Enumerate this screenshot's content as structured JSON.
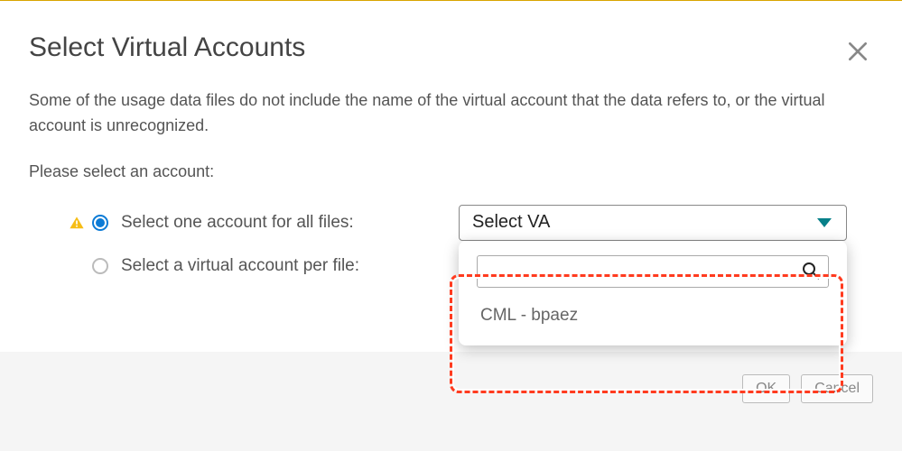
{
  "dialog": {
    "title": "Select Virtual Accounts",
    "description": "Some of the usage data files do not include the name of the virtual account that the data refers to, or the virtual account is unrecognized.",
    "prompt": "Please select an account:",
    "options": {
      "all_files_label": "Select one account for all files:",
      "per_file_label": "Select a virtual account per file:",
      "selected": "all_files"
    },
    "select": {
      "placeholder": "Select VA",
      "search_value": "",
      "items": [
        "CML - bpaez"
      ]
    },
    "buttons": {
      "ok": "OK",
      "cancel": "Cancel"
    }
  },
  "icons": {
    "close": "close-icon",
    "warning": "warning-icon",
    "search": "search-icon",
    "caret": "caret-icon"
  },
  "colors": {
    "accent": "#0c7bd6",
    "teal_caret": "#068089",
    "highlight": "#ff3b1f",
    "gold": "#d9a500"
  }
}
